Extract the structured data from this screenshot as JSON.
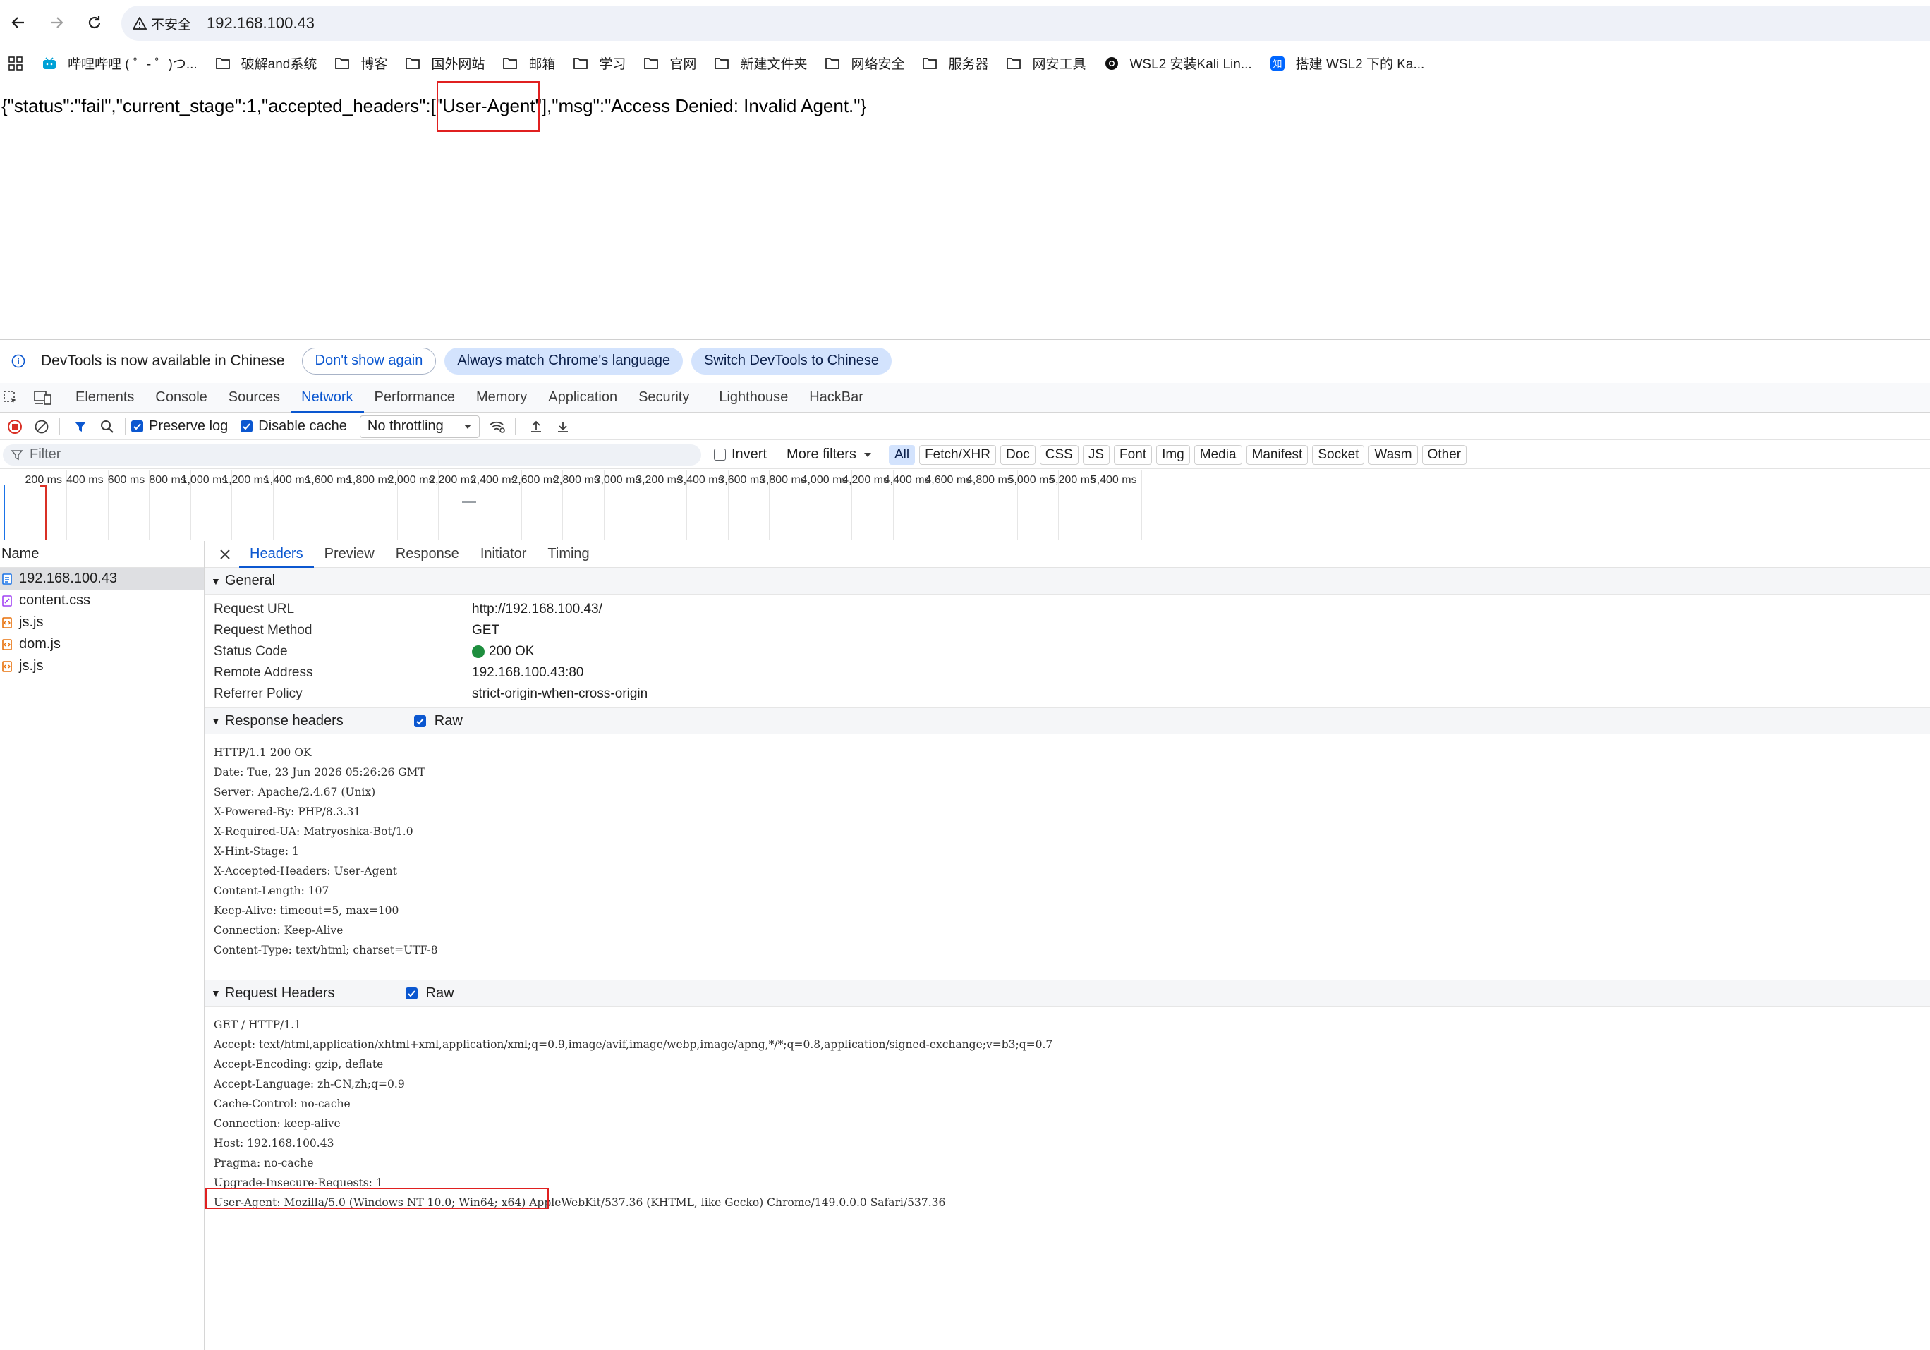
{
  "browser": {
    "security_label": "不安全",
    "url": "192.168.100.43",
    "bookmarks": [
      {
        "icon": "bilibili-icon",
        "label": "哔哩哔哩 ( ゜- ゜)つ..."
      },
      {
        "icon": "folder-icon",
        "label": "破解and系统"
      },
      {
        "icon": "folder-icon",
        "label": "博客"
      },
      {
        "icon": "folder-icon",
        "label": "国外网站"
      },
      {
        "icon": "folder-icon",
        "label": "邮箱"
      },
      {
        "icon": "folder-icon",
        "label": "学习"
      },
      {
        "icon": "folder-icon",
        "label": "官网"
      },
      {
        "icon": "folder-icon",
        "label": "新建文件夹"
      },
      {
        "icon": "folder-icon",
        "label": "网络安全"
      },
      {
        "icon": "folder-icon",
        "label": "服务器"
      },
      {
        "icon": "folder-icon",
        "label": "网安工具"
      },
      {
        "icon": "github-icon",
        "label": "WSL2 安装Kali Lin..."
      },
      {
        "icon": "zhihu-icon",
        "label": "搭建 WSL2 下的 Ka..."
      }
    ]
  },
  "page": {
    "json_before": "{\"status\":\"fail\",\"current_stage\":1,\"accepted_headers\":[",
    "json_highlight": "\"User-Agent\"",
    "json_after": "],\"msg\":\"Access Denied: Invalid Agent.\"}"
  },
  "devtools": {
    "infobar": {
      "text": "DevTools is now available in Chinese",
      "dont_show": "Don't show again",
      "always_match": "Always match Chrome's language",
      "switch": "Switch DevTools to Chinese"
    },
    "panel_tabs": [
      "Elements",
      "Console",
      "Sources",
      "Network",
      "Performance",
      "Memory",
      "Application",
      "Security",
      "Lighthouse",
      "HackBar"
    ],
    "active_panel": "Network",
    "toolbar": {
      "preserve_log": "Preserve log",
      "disable_cache": "Disable cache",
      "throttling": "No throttling"
    },
    "filter": {
      "placeholder": "Filter",
      "invert": "Invert",
      "more_filters": "More filters",
      "chips": [
        "All",
        "Fetch/XHR",
        "Doc",
        "CSS",
        "JS",
        "Font",
        "Img",
        "Media",
        "Manifest",
        "Socket",
        "Wasm",
        "Other"
      ]
    },
    "timeline_ticks": [
      "200 ms",
      "400 ms",
      "600 ms",
      "800 ms",
      "1,000 ms",
      "1,200 ms",
      "1,400 ms",
      "1,600 ms",
      "1,800 ms",
      "2,000 ms",
      "2,200 ms",
      "2,400 ms",
      "2,600 ms",
      "2,800 ms",
      "3,000 ms",
      "3,200 ms",
      "3,400 ms",
      "3,600 ms",
      "3,800 ms",
      "4,000 ms",
      "4,200 ms",
      "4,400 ms",
      "4,600 ms",
      "4,800 ms",
      "5,000 ms",
      "5,200 ms",
      "5,400 ms"
    ],
    "name_header": "Name",
    "requests": [
      {
        "name": "192.168.100.43",
        "type": "doc"
      },
      {
        "name": "content.css",
        "type": "css"
      },
      {
        "name": "js.js",
        "type": "script"
      },
      {
        "name": "dom.js",
        "type": "script"
      },
      {
        "name": "js.js",
        "type": "script"
      }
    ],
    "detail_tabs": [
      "Headers",
      "Preview",
      "Response",
      "Initiator",
      "Timing"
    ],
    "general": {
      "title": "General",
      "rows": [
        {
          "k": "Request URL",
          "v": "http://192.168.100.43/"
        },
        {
          "k": "Request Method",
          "v": "GET"
        },
        {
          "k": "Status Code",
          "v": "200 OK"
        },
        {
          "k": "Remote Address",
          "v": "192.168.100.43:80"
        },
        {
          "k": "Referrer Policy",
          "v": "strict-origin-when-cross-origin"
        }
      ]
    },
    "response_headers": {
      "title": "Response headers",
      "raw_label": "Raw",
      "lines": [
        "HTTP/1.1 200 OK",
        "Date: Tue, 23 Jun 2026 05:26:26 GMT",
        "Server: Apache/2.4.67 (Unix)",
        "X-Powered-By: PHP/8.3.31",
        "X-Required-UA: Matryoshka-Bot/1.0",
        "X-Hint-Stage: 1",
        "X-Accepted-Headers: User-Agent",
        "Content-Length: 107",
        "Keep-Alive: timeout=5, max=100",
        "Connection: Keep-Alive",
        "Content-Type: text/html; charset=UTF-8"
      ]
    },
    "request_headers": {
      "title": "Request Headers",
      "raw_label": "Raw",
      "lines": [
        "GET / HTTP/1.1",
        "Accept: text/html,application/xhtml+xml,application/xml;q=0.9,image/avif,image/webp,image/apng,*/*;q=0.8,application/signed-exchange;v=b3;q=0.7",
        "Accept-Encoding: gzip, deflate",
        "Accept-Language: zh-CN,zh;q=0.9",
        "Cache-Control: no-cache",
        "Connection: keep-alive",
        "Host: 192.168.100.43",
        "Pragma: no-cache",
        "Upgrade-Insecure-Requests: 1",
        "User-Agent: Mozilla/5.0 (Windows NT 10.0; Win64; x64) AppleWebKit/537.36 (KHTML, like Gecko) Chrome/149.0.0.0 Safari/537.36"
      ]
    }
  }
}
